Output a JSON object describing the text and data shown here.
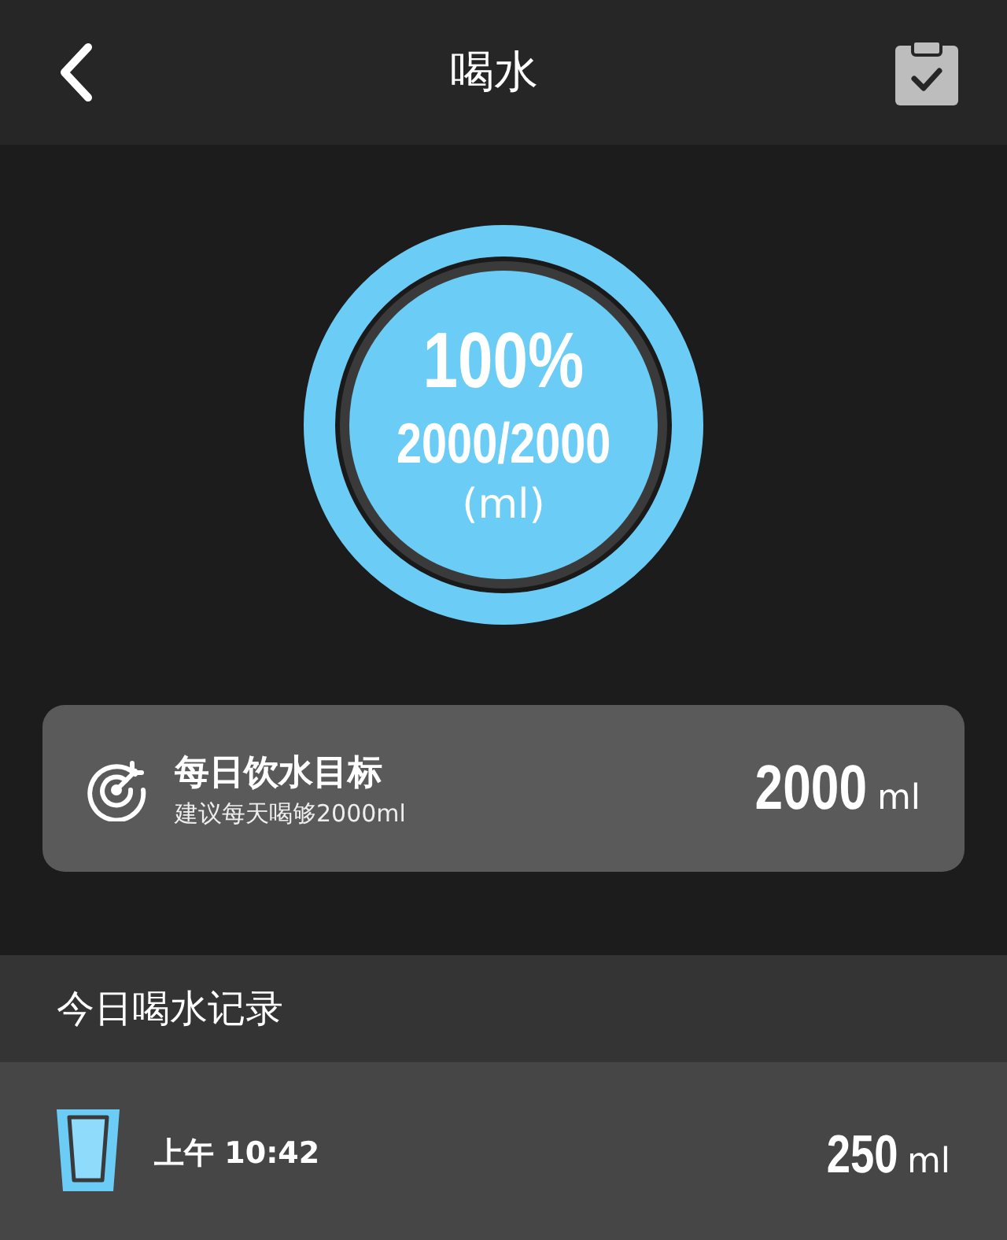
{
  "header": {
    "title": "喝水"
  },
  "progress": {
    "level": 1,
    "percent": "100%",
    "amount": "2000/2000",
    "unit": "(ml)"
  },
  "goal_card": {
    "title": "每日饮水目标",
    "subtitle": "建议每天喝够2000ml",
    "value": "2000",
    "unit": "ml"
  },
  "records": {
    "title": "今日喝水记录",
    "items": [
      {
        "period": "上午",
        "time": "10:42",
        "value": "250",
        "unit": "ml"
      }
    ]
  }
}
